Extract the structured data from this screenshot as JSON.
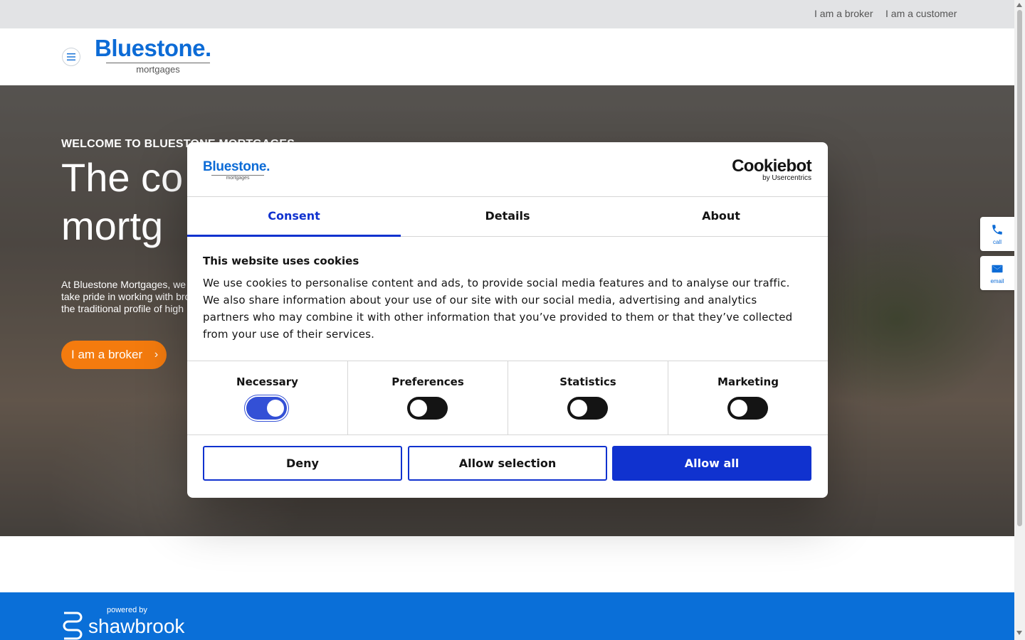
{
  "topbar": {
    "broker_link": "I am a broker",
    "customer_link": "I am a customer"
  },
  "header": {
    "logo_word": "Bluestone",
    "logo_dot": ".",
    "logo_sub": "mortgages"
  },
  "hero": {
    "kicker": "WELCOME TO BLUESTONE MORTGAGES",
    "headline_line1": "The co",
    "headline_line2": "mortg",
    "body_line1": "At Bluestone Mortgages, we p",
    "body_line2": "take pride in working with bro",
    "body_line3": "the traditional profile of high",
    "cta_label": "I am a broker",
    "cta_chevron": "›"
  },
  "side_tabs": {
    "call_label": "call",
    "email_label": "email"
  },
  "footer": {
    "powered_by": "powered by",
    "brand": "shawbrook"
  },
  "cookie_dialog": {
    "logo_word": "Bluestone.",
    "logo_sub": "mortgages",
    "provider_name": "Cookiebot",
    "provider_sub": "by Usercentrics",
    "tabs": [
      {
        "label": "Consent",
        "active": true
      },
      {
        "label": "Details",
        "active": false
      },
      {
        "label": "About",
        "active": false
      }
    ],
    "heading": "This website uses cookies",
    "body": "We use cookies to personalise content and ads, to provide social media features and to analyse our traffic. We also share information about your use of our site with our social media, advertising and analytics partners who may combine it with other information that you’ve provided to them or that they’ve collected from your use of their services.",
    "categories": [
      {
        "label": "Necessary",
        "enabled": true
      },
      {
        "label": "Preferences",
        "enabled": false
      },
      {
        "label": "Statistics",
        "enabled": false
      },
      {
        "label": "Marketing",
        "enabled": false
      }
    ],
    "buttons": {
      "deny": "Deny",
      "allow_selection": "Allow selection",
      "allow_all": "Allow all"
    },
    "accent_color": "#1032cf"
  },
  "colors": {
    "brand_blue": "#0c6bd6",
    "cta_orange": "#f47b0e",
    "footer_blue": "#0a6fd8"
  }
}
